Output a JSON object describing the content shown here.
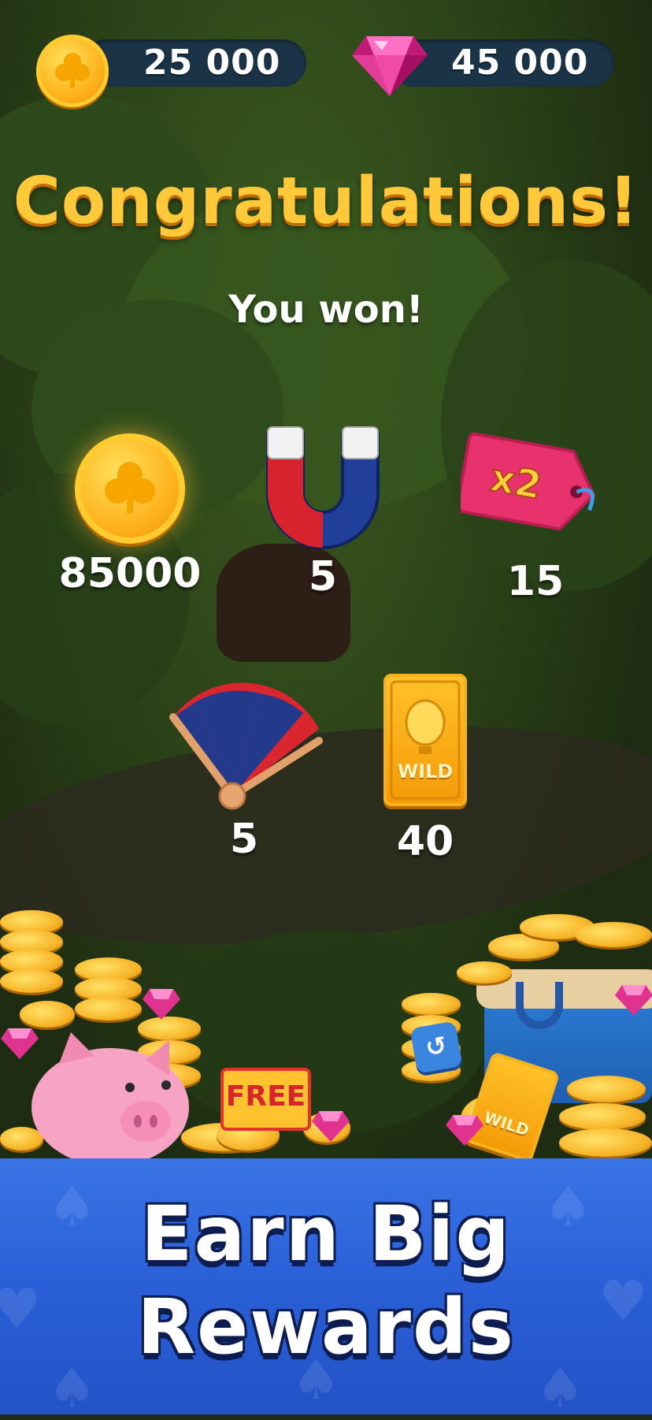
{
  "currencies": {
    "coins": {
      "amount": "25 000",
      "icon": "clover-coin-icon"
    },
    "gems": {
      "amount": "45 000",
      "icon": "gem-icon"
    }
  },
  "heading": "Congratulations!",
  "subheading": "You won!",
  "rewards": [
    {
      "name": "coins",
      "icon": "clover-coin-icon",
      "value": "85000"
    },
    {
      "name": "magnet",
      "icon": "magnet-icon",
      "value": "5"
    },
    {
      "name": "x2-tag",
      "icon": "x2-tag-icon",
      "value": "15",
      "tag_text": "x2"
    },
    {
      "name": "fan",
      "icon": "fan-icon",
      "value": "5"
    },
    {
      "name": "wild-card",
      "icon": "wild-card-icon",
      "value": "40",
      "card_text": "WILD"
    }
  ],
  "decor": {
    "free_tag": "FREE",
    "wild_card": "WILD"
  },
  "banner": {
    "line1": "Earn Big",
    "line2": "Rewards"
  },
  "colors": {
    "title": "#ffc93a",
    "banner": "#2a5fd7",
    "pill": "#1b3346",
    "gold": "#f8b62a",
    "gem": "#e0338f"
  }
}
